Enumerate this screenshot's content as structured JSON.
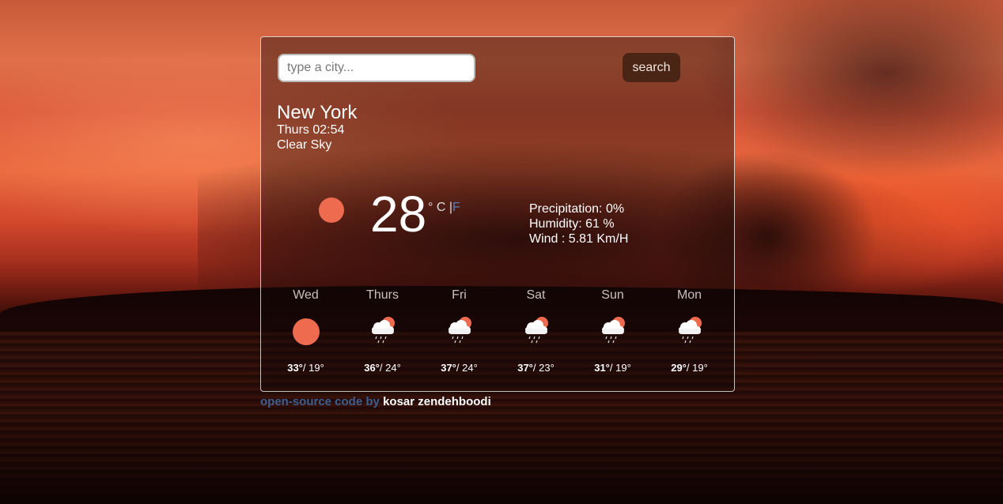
{
  "search": {
    "placeholder": "type a city...",
    "value": "",
    "button_label": "search"
  },
  "current": {
    "city": "New York",
    "datetime": "Thurs 02:54",
    "description": "Clear Sky",
    "icon": "clear-sky-icon",
    "temperature": "28",
    "unit_c": "° C",
    "unit_sep": "|",
    "unit_f": "F",
    "precipitation": "Precipitation: 0%",
    "humidity": "Humidity: 61 %",
    "wind": "Wind : 5.81 Km/H"
  },
  "forecast": [
    {
      "day": "Wed",
      "icon": "clear-sky-icon",
      "max": "33°",
      "min": "/ 19°"
    },
    {
      "day": "Thurs",
      "icon": "rain-icon",
      "max": "36°",
      "min": "/ 24°"
    },
    {
      "day": "Fri",
      "icon": "rain-icon",
      "max": "37°",
      "min": "/ 24°"
    },
    {
      "day": "Sat",
      "icon": "rain-icon",
      "max": "37°",
      "min": "/ 23°"
    },
    {
      "day": "Sun",
      "icon": "rain-icon",
      "max": "31°",
      "min": "/ 19°"
    },
    {
      "day": "Mon",
      "icon": "rain-icon",
      "max": "29°",
      "min": "/ 19°"
    }
  ],
  "footer": {
    "link_text": "open-source code",
    "by": "by",
    "author": "kosar zendehboodi"
  },
  "colors": {
    "sun": "#ee6b50",
    "button": "#4a2414",
    "link": "#3f5e8e"
  }
}
